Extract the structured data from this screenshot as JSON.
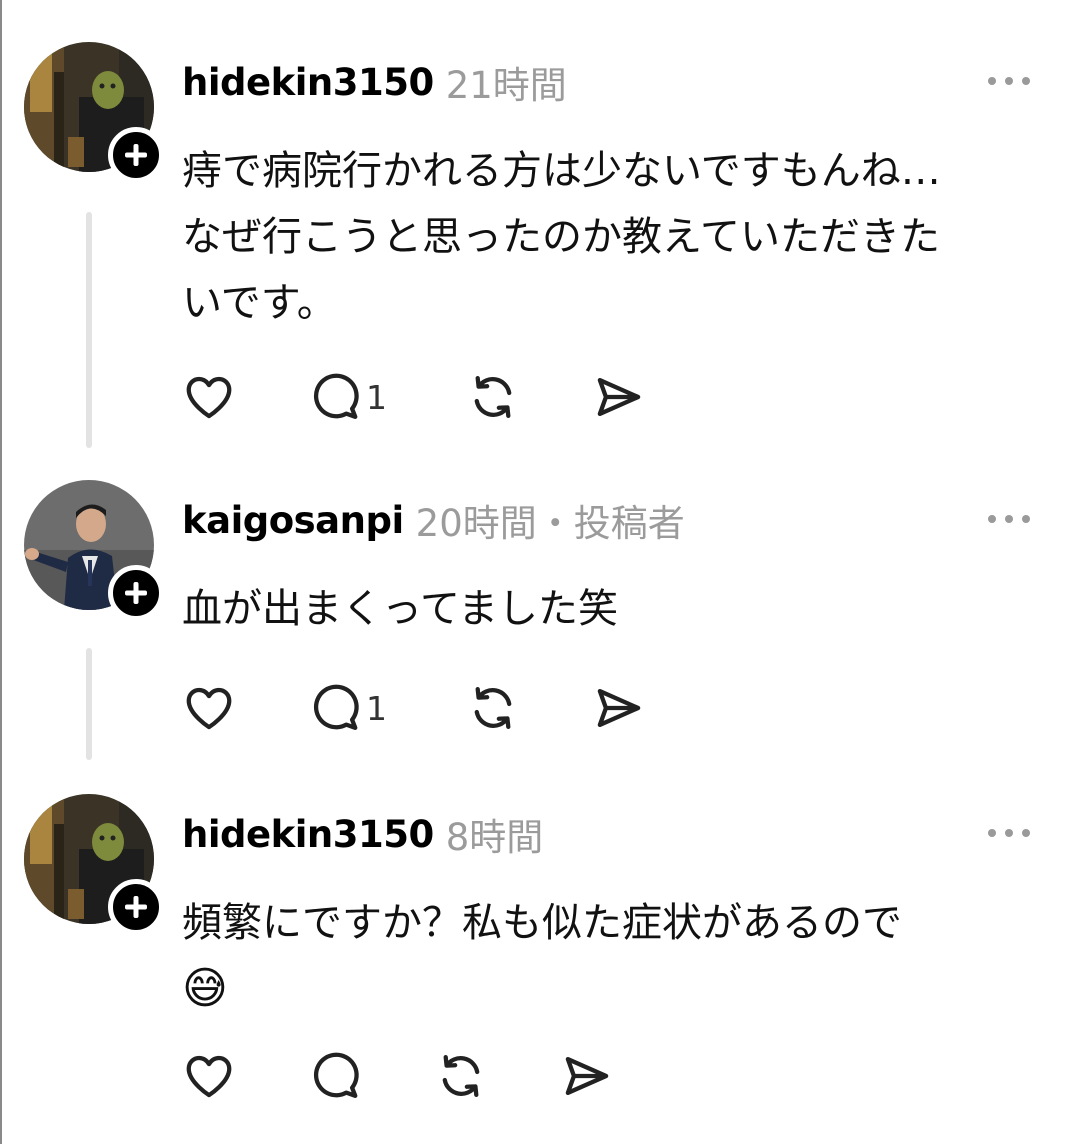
{
  "posts": [
    {
      "username": "hidekin3150",
      "time": "21時間",
      "lines": [
        "痔で病院行かれる方は少ないですもんね…",
        "なぜ行こうと思ったのか教えていただきた",
        "いです。"
      ],
      "reply_count": "1",
      "avatar": "masked-man-photo"
    },
    {
      "username": "kaigosanpi",
      "time": "20時間・投稿者",
      "lines": [
        "血が出まくってました笑"
      ],
      "reply_count": "1",
      "avatar": "man-in-suit-pointing-photo"
    },
    {
      "username": "hidekin3150",
      "time": "8時間",
      "lines": [
        "頻繁にですか？私も似た症状があるので"
      ],
      "emoji": "😅",
      "reply_count": "",
      "avatar": "masked-man-photo"
    }
  ],
  "icons": {
    "like": "heart-icon",
    "reply": "comment-icon",
    "repost": "repost-icon",
    "share": "send-icon",
    "more": "more-dots-icon",
    "follow": "plus-icon"
  },
  "colors": {
    "meta_gray": "#9b9b9b",
    "thread_line": "#e3e3e3",
    "icon_dark": "#222222"
  }
}
